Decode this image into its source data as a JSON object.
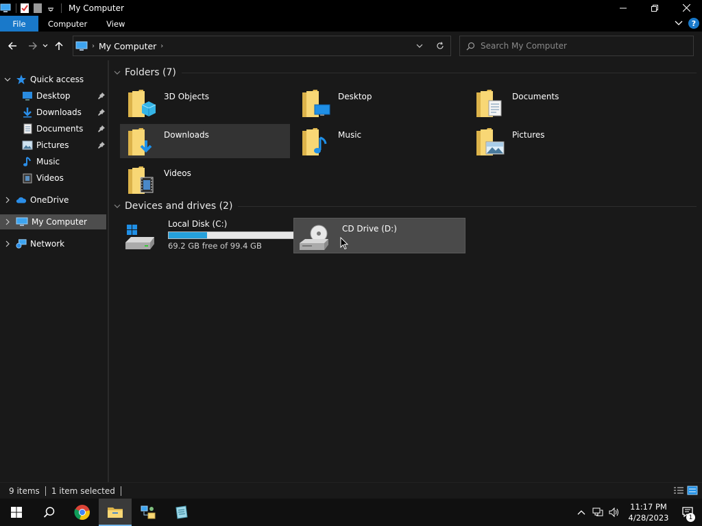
{
  "window": {
    "title": "My Computer"
  },
  "ribbon": {
    "tabs": [
      {
        "label": "File"
      },
      {
        "label": "Computer"
      },
      {
        "label": "View"
      }
    ]
  },
  "address": {
    "location": "My Computer"
  },
  "search": {
    "placeholder": "Search My Computer"
  },
  "sidebar": {
    "quick_access": "Quick access",
    "items": [
      {
        "label": "Desktop",
        "pinned": true
      },
      {
        "label": "Downloads",
        "pinned": true
      },
      {
        "label": "Documents",
        "pinned": true
      },
      {
        "label": "Pictures",
        "pinned": true
      },
      {
        "label": "Music",
        "pinned": false
      },
      {
        "label": "Videos",
        "pinned": false
      }
    ],
    "onedrive": "OneDrive",
    "mycomputer": "My Computer",
    "network": "Network"
  },
  "content": {
    "folders_header": "Folders (7)",
    "folders": [
      {
        "name": "3D Objects"
      },
      {
        "name": "Desktop"
      },
      {
        "name": "Documents"
      },
      {
        "name": "Downloads"
      },
      {
        "name": "Music"
      },
      {
        "name": "Pictures"
      },
      {
        "name": "Videos"
      }
    ],
    "drives_header": "Devices and drives (2)",
    "drives": [
      {
        "name": "Local Disk (C:)",
        "free_text": "69.2 GB free of 99.4 GB",
        "used_fraction": 0.3
      },
      {
        "name": "CD Drive (D:)"
      }
    ]
  },
  "status": {
    "items": "9 items",
    "selected": "1 item selected"
  },
  "taskbar": {
    "time": "11:17 PM",
    "date": "4/28/2023",
    "notification_count": "1"
  },
  "colors": {
    "accent": "#1979ca",
    "background": "#191919",
    "selection": "#4d4d4d",
    "drive_bar": "#26a0da",
    "folder_yellow": "#f8d775"
  }
}
